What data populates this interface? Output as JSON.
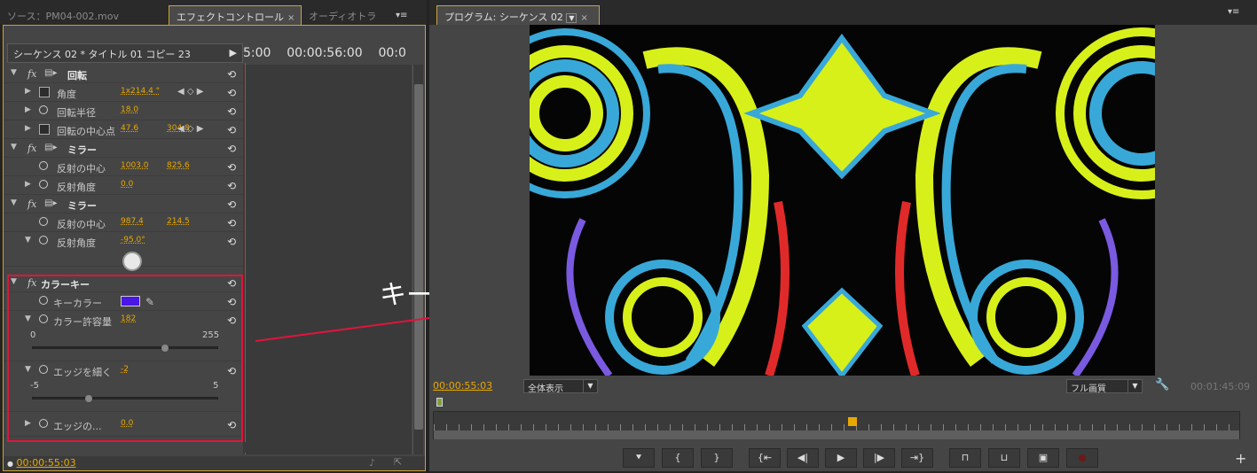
{
  "left_tabs": {
    "source": "ソース：PM04-002.mov",
    "effect_controls": "エフェクトコントロール",
    "audio": "オーディオトラ",
    "close": "×",
    "menu": "▾≡"
  },
  "effect_controls": {
    "sequence_clip": "シーケンス 02 * タイトル 01 コピー 23",
    "arrow": "▶",
    "timeline_header": "5:00    00:00:56:00    00:0",
    "rows": [
      {
        "type": "effect",
        "name": "回転"
      },
      {
        "type": "param",
        "name": "角度",
        "v1": "1x214.4 °"
      },
      {
        "type": "param",
        "name": "回転半径",
        "v1": "18.0"
      },
      {
        "type": "param",
        "name": "回転の中心点",
        "v1": "47.6",
        "v2": "304.8"
      },
      {
        "type": "effect",
        "name": "ミラー"
      },
      {
        "type": "param",
        "name": "反射の中心",
        "v1": "1003.0",
        "v2": "825.6"
      },
      {
        "type": "param",
        "name": "反射角度",
        "v1": "0.0"
      },
      {
        "type": "effect",
        "name": "ミラー"
      },
      {
        "type": "param",
        "name": "反射の中心",
        "v1": "987.4",
        "v2": "214.5"
      },
      {
        "type": "param",
        "name": "反射角度",
        "v1": "-95.0°"
      }
    ],
    "color_key": {
      "name": "カラーキー",
      "key_color_label": "キーカラー",
      "key_color": "#4a17e8",
      "tolerance_label": "カラー許容量",
      "tolerance_value": "182",
      "tolerance_min": "0",
      "tolerance_max": "255",
      "tolerance_level": 0.71,
      "thin_label": "エッジを細く",
      "thin_value": "-2",
      "thin_min": "-5",
      "thin_max": "5",
      "thin_level": 0.3,
      "feather_label": "エッジの...",
      "feather_value": "0.0"
    },
    "current_time": "00:00:55:03",
    "fx": "fx",
    "reset": "⟲"
  },
  "program": {
    "tab": "プログラム: シーケンス 02",
    "close": "×",
    "menu": "▾≡",
    "current_time": "00:00:55:03",
    "zoom": "全体表示",
    "quality": "フル画質",
    "duration": "00:01:45:09",
    "playhead_position": 0.52
  },
  "annotation": "キーアウト",
  "accent_color": "#e8a800",
  "highlight_color": "#e0143c"
}
